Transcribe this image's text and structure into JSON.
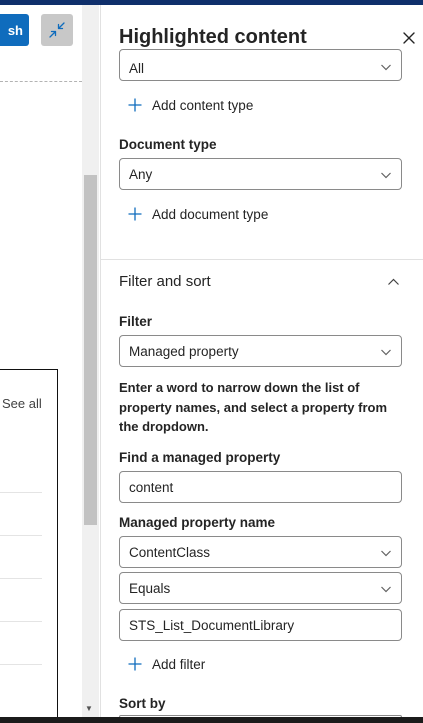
{
  "canvas": {
    "publish_label": "sh",
    "see_all": "See all"
  },
  "panel": {
    "title": "Highlighted content",
    "content_type_value": "All",
    "add_content_type": "Add content type",
    "document_type_label": "Document type",
    "document_type_value": "Any",
    "add_document_type": "Add document type",
    "filter_sort_title": "Filter and sort",
    "filter_label": "Filter",
    "filter_value": "Managed property",
    "help_text": "Enter a word to narrow down the list of property names, and select a property from the dropdown.",
    "find_label": "Find a managed property",
    "find_value": "content",
    "property_name_label": "Managed property name",
    "property_name_value": "ContentClass",
    "operator_value": "Equals",
    "filter_text_value": "STS_List_DocumentLibrary",
    "add_filter": "Add filter",
    "sort_by_label": "Sort by"
  },
  "colors": {
    "accent": "#0f6cbd",
    "top_bar": "#0f2f6b"
  }
}
